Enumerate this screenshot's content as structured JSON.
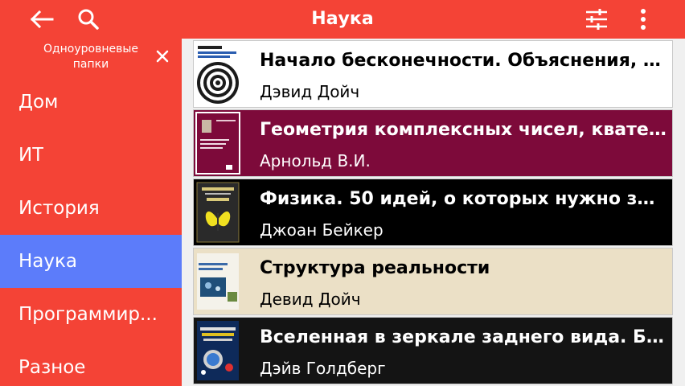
{
  "header": {
    "title": "Наука",
    "back_icon": "arrow-left-icon",
    "search_icon": "search-icon",
    "filter_icon": "sliders-icon",
    "more_icon": "more-vertical-icon",
    "bar_color": "#f44336"
  },
  "sidebar": {
    "header_label": "Одноуровневые папки",
    "close_icon": "close-icon",
    "items": [
      {
        "label": "Дом"
      },
      {
        "label": "ИТ"
      },
      {
        "label": "История"
      },
      {
        "label": "Наука",
        "active": true
      },
      {
        "label": "Программир..."
      },
      {
        "label": "Разное"
      }
    ],
    "active_color": "#5c7cfa"
  },
  "books": [
    {
      "title": "Начало бесконечности. Объяснения, к...",
      "author": "Дэвид Дойч",
      "bg": "#ffffff",
      "fg": "#000000"
    },
    {
      "title": "Геометрия комплексных чисел, кватер...",
      "author": "Арнольд В.И.",
      "bg": "#7d0a3a",
      "fg": "#ffffff"
    },
    {
      "title": "Физика. 50 идей, о которых нужно знать",
      "author": "Джоан Бейкер",
      "bg": "#000000",
      "fg": "#ffffff"
    },
    {
      "title": "Структура реальности",
      "author": "Девид Дойч",
      "bg": "#ebe0c6",
      "fg": "#000000"
    },
    {
      "title": "Вселенная в зеркале заднего вида. Бы...",
      "author": "Дэйв Голдберг",
      "bg": "#141414",
      "fg": "#ffffff"
    }
  ]
}
